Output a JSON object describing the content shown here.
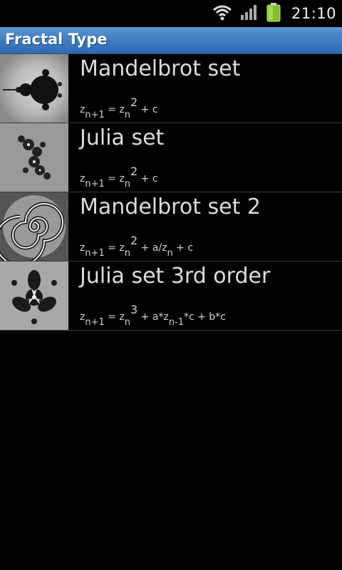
{
  "status_bar": {
    "time": "21:10",
    "icons": [
      "wifi-icon",
      "signal-icon",
      "battery-icon"
    ],
    "battery_color": "#9acd32"
  },
  "titlebar": {
    "title": "Fractal Type",
    "color": "#3f7dc3"
  },
  "fractals": [
    {
      "name": "Mandelbrot set",
      "formula": {
        "lhs_base": "z",
        "lhs_sub": "n+1",
        "eq": " = ",
        "t1_base": "z",
        "t1_sub": "n",
        "t1_sup": "2",
        "tail": " + c"
      }
    },
    {
      "name": "Julia set",
      "formula": {
        "lhs_base": "z",
        "lhs_sub": "n+1",
        "eq": " = ",
        "t1_base": "z",
        "t1_sub": "n",
        "t1_sup": "2",
        "tail": " + c"
      }
    },
    {
      "name": "Mandelbrot set 2",
      "formula": {
        "lhs_base": "z",
        "lhs_sub": "n+1",
        "eq": " = ",
        "t1_base": "z",
        "t1_sub": "n",
        "t1_sup": "2",
        "mid": " + a/z",
        "mid_sub": "n",
        "tail": " + c"
      }
    },
    {
      "name": "Julia set 3rd order",
      "formula": {
        "lhs_base": "z",
        "lhs_sub": "n+1",
        "eq": " = ",
        "t1_base": "z",
        "t1_sub": "n",
        "t1_sup": "3",
        "mid": " + a*z",
        "mid_sub": "n-1",
        "tail": "*c + b*c"
      }
    }
  ]
}
